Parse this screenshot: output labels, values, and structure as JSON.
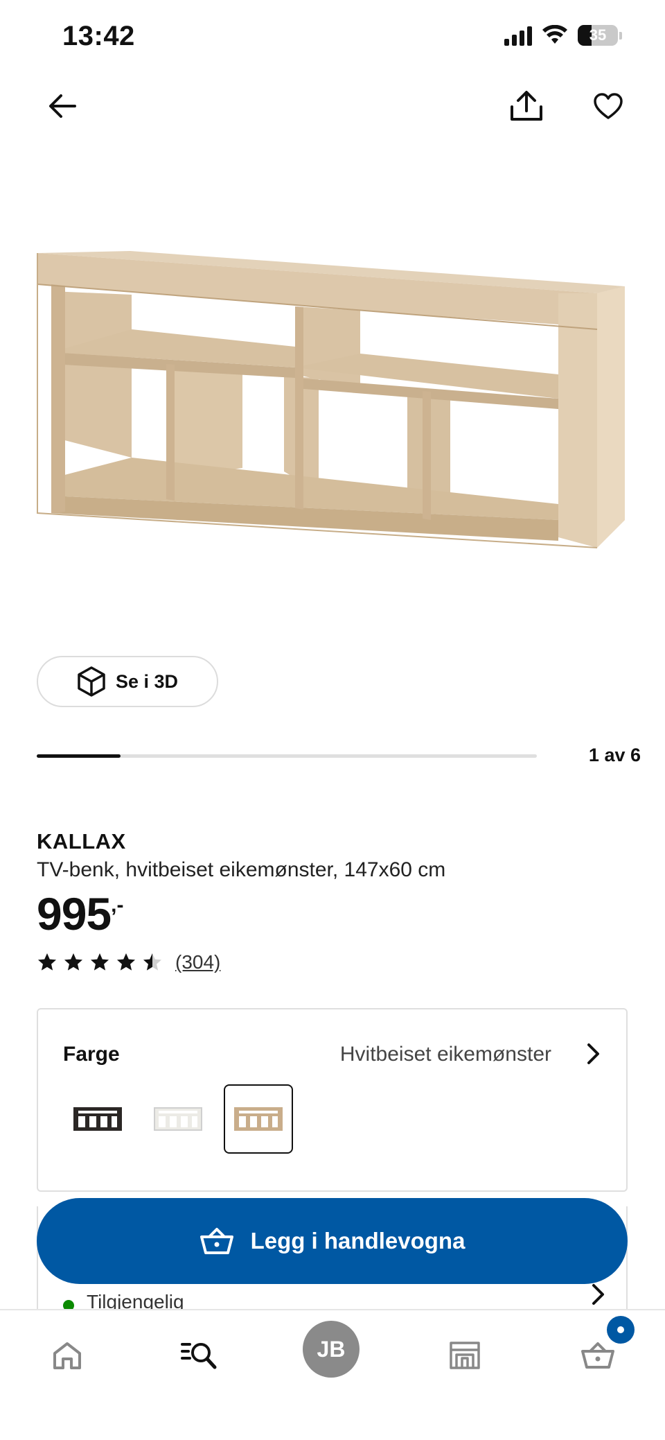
{
  "status_bar": {
    "time": "13:42",
    "battery_level": "35",
    "icons": [
      "signal-icon",
      "wifi-icon",
      "battery-icon"
    ]
  },
  "top_nav": {
    "icons": [
      "back-arrow-icon",
      "share-icon",
      "heart-icon"
    ]
  },
  "gallery": {
    "view_3d_label": "Se i 3D",
    "counter": "1 av 6",
    "progress_fraction": 0.167
  },
  "product": {
    "name": "KALLAX",
    "description": "TV-benk, hvitbeiset eikemønster, 147x60 cm",
    "price": "995",
    "price_suffix": ",-",
    "rating": 4.5,
    "review_count": "(304)"
  },
  "color_selector": {
    "label": "Farge",
    "selected_value": "Hvitbeiset eikemønster",
    "swatches": [
      {
        "color": "#2b2725",
        "selected": false
      },
      {
        "color": "#ecebe6",
        "selected": false
      },
      {
        "color": "#c9ad8a",
        "selected": true
      }
    ]
  },
  "availability": {
    "text": "Tilgjengelig",
    "status_color": "#0a8a00"
  },
  "cta": {
    "add_to_cart_label": "Legg i handlevogna",
    "color": "#0058a3"
  },
  "tab_bar": {
    "profile_initials": "JB",
    "icons": [
      "home-icon",
      "search-list-icon",
      "profile-avatar",
      "store-icon",
      "basket-icon"
    ]
  }
}
